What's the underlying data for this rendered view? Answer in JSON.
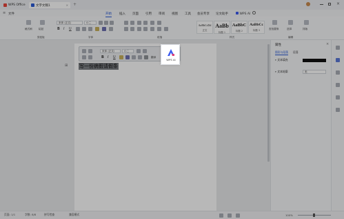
{
  "titlebar": {
    "app_tab": "WPS Office",
    "doc_tab": "文字文稿1",
    "new_tab": "+"
  },
  "menubar": {
    "file": "文件",
    "items": [
      "开始",
      "插入",
      "页面",
      "引用",
      "审阅",
      "视图",
      "工具",
      "会员专享",
      "论文助手"
    ],
    "ai": "WPS AI",
    "search_icon": "search-icon"
  },
  "ribbon": {
    "labels": [
      "格式刷",
      "粘贴",
      "剪贴板",
      "字体",
      "段落",
      "样式",
      "查找替换",
      "选择",
      "排版",
      "编辑"
    ],
    "font_name": "宋体 (正文)",
    "font_size": "小二",
    "styles": [
      {
        "sample": "AaBbCcDd",
        "name": "正文"
      },
      {
        "sample": "AaBb",
        "name": "标题 1"
      },
      {
        "sample": "AaBbC",
        "name": "标题 2"
      },
      {
        "sample": "AaBbCc",
        "name": "标题 3"
      }
    ]
  },
  "minibar": {
    "font_name": "宋体 (正文)",
    "font_size": "小二",
    "ai_label": "WPS AI",
    "more": "翻译"
  },
  "document": {
    "selected_text": "写一份病假请假条"
  },
  "right_panel": {
    "title": "属性",
    "tabs": [
      "图形与段落",
      "段落"
    ],
    "row1_label": "文本填充",
    "row2_label": "文本轮廓",
    "row2_value": "无"
  },
  "statusbar": {
    "page": "页面: 1/1",
    "words": "字数: 8/8",
    "spell": "拼写检查",
    "compat": "兼容模式",
    "zoom": "100%"
  },
  "colors": {
    "accent": "#2a5bd7",
    "ai_logo": "#3c5bf0"
  }
}
